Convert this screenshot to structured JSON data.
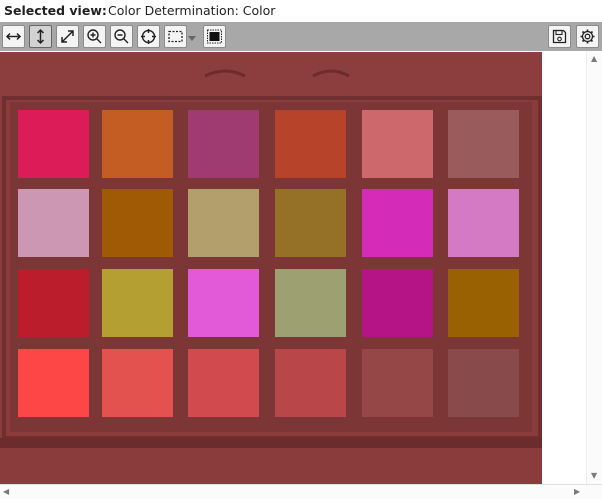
{
  "header": {
    "label": "Selected view:",
    "value": "Color Determination: Color"
  },
  "toolbar": {
    "tools": [
      {
        "name": "pan-horizontal-button",
        "icon": "arrows-horizontal-icon",
        "active": false
      },
      {
        "name": "pan-vertical-button",
        "icon": "arrows-vertical-icon",
        "active": true
      },
      {
        "name": "fit-view-button",
        "icon": "arrows-diagonal-icon",
        "active": false
      },
      {
        "name": "zoom-in-button",
        "icon": "zoom-in-icon",
        "active": false
      },
      {
        "name": "zoom-out-button",
        "icon": "zoom-out-icon",
        "active": false
      },
      {
        "name": "center-view-button",
        "icon": "crosshair-icon",
        "active": false
      },
      {
        "name": "selection-button",
        "icon": "dashed-rectangle-icon",
        "active": false
      },
      {
        "name": "fill-selection-button",
        "icon": "filled-rectangle-icon",
        "active": false
      }
    ],
    "right_tools": [
      {
        "name": "save-button",
        "icon": "floppy-disk-icon"
      },
      {
        "name": "settings-button",
        "icon": "gear-icon"
      }
    ]
  },
  "color_chart": {
    "frame_color": "#8a3b3b",
    "background_color": "#7d3636",
    "patches": [
      [
        "#dc1c58",
        "#c45d23",
        "#a03b71",
        "#b6432a",
        "#cd686c",
        "#9a5b5d"
      ],
      [
        "#cc97b2",
        "#a05904",
        "#b39f6b",
        "#957027",
        "#d52bb9",
        "#d47ac4"
      ],
      [
        "#bb1d2c",
        "#b4a032",
        "#e35ad9",
        "#9da172",
        "#b41485",
        "#996101"
      ],
      [
        "#fc4746",
        "#e3524e",
        "#d14a4d",
        "#b94648",
        "#954748",
        "#884a4a"
      ]
    ]
  }
}
